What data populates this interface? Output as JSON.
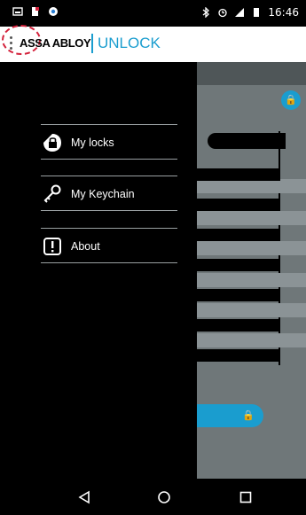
{
  "status_bar": {
    "time": "16:46",
    "icons": [
      "gallery-icon",
      "sim-icon",
      "chrome-icon",
      "bluetooth-icon",
      "alarm-icon",
      "signal-icon",
      "battery-icon"
    ]
  },
  "app_bar": {
    "brand": "ASSA ABLOY",
    "app_name": "UNLOCK",
    "accent": "#1a9dcf"
  },
  "drawer": {
    "items": [
      {
        "label": "My locks",
        "icon": "lock-icon"
      },
      {
        "label": "My Keychain",
        "icon": "key-icon"
      },
      {
        "label": "About",
        "icon": "info-icon"
      }
    ]
  },
  "nav_bar": {
    "buttons": [
      "back-icon",
      "home-icon",
      "recents-icon"
    ]
  },
  "colors": {
    "annotation": "#d3203a",
    "drawer_bg": "#000000",
    "scrim": "#6f7779"
  }
}
